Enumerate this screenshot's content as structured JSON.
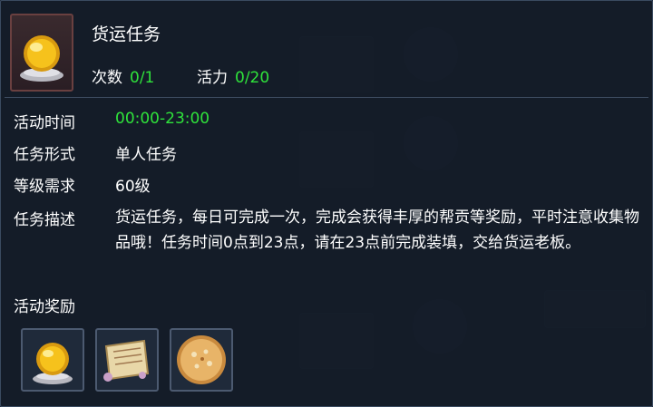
{
  "task": {
    "title": "货运任务",
    "count_label": "次数",
    "count_value": "0/1",
    "vitality_label": "活力",
    "vitality_value": "0/20"
  },
  "details": {
    "time_label": "活动时间",
    "time_value": "00:00-23:00",
    "form_label": "任务形式",
    "form_value": "单人任务",
    "level_label": "等级需求",
    "level_value": "60级",
    "desc_label": "任务描述",
    "desc_value": "货运任务，每日可完成一次，完成会获得丰厚的帮贡等奖励，平时注意收集物品哦！任务时间0点到23点，请在23点前完成装填，交给货运老板。"
  },
  "rewards": {
    "label": "活动奖励",
    "items": [
      {
        "icon": "golden-orb-icon"
      },
      {
        "icon": "scroll-icon"
      },
      {
        "icon": "pancake-icon"
      }
    ]
  },
  "colors": {
    "highlight_green": "#2fe33b",
    "panel_bg": "#141c28"
  }
}
